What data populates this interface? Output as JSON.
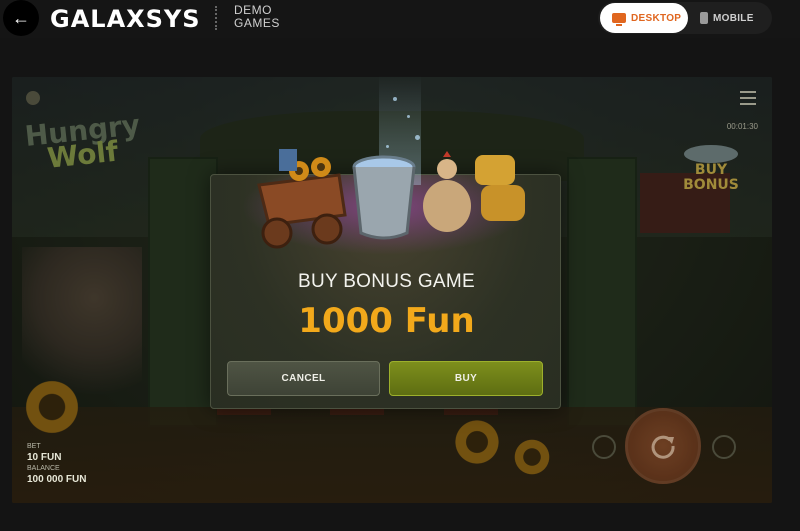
{
  "topbar": {
    "back_label": "←",
    "brand": "GALAXSYS",
    "demo_line1": "DEMO",
    "demo_line2": "GAMES",
    "desktop_label": "DESKTOP",
    "mobile_label": "MOBILE"
  },
  "game": {
    "logo_line1": "Hungry",
    "logo_line2": "Wolf",
    "buy_bonus_line1": "BUY",
    "buy_bonus_line2": "BONUS",
    "clock": "00:01:30",
    "bet_label": "BET",
    "bet_value": "10 FUN",
    "balance_label": "BALANCE",
    "balance_value": "100 000 FUN"
  },
  "modal": {
    "title": "BUY BONUS GAME",
    "price": "1000 Fun",
    "cancel_label": "CANCEL",
    "buy_label": "BUY"
  },
  "colors": {
    "accent_orange": "#e0661f",
    "price_gold": "#f2a91b",
    "buy_green": "#7d8f1c"
  }
}
